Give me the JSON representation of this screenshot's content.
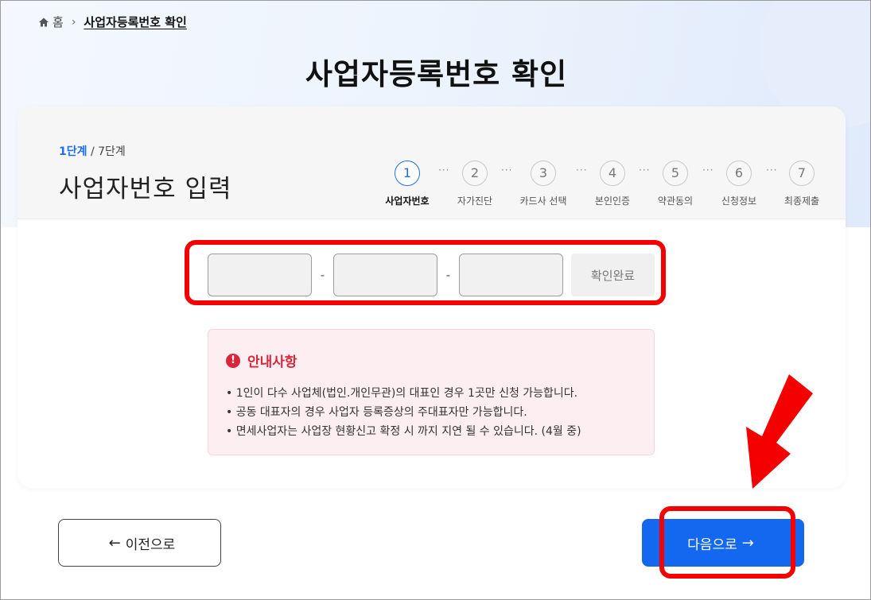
{
  "breadcrumb": {
    "home": "홈",
    "current": "사업자등록번호 확인"
  },
  "page_title": "사업자등록번호 확인",
  "step_indicator": {
    "current": "1단계",
    "total": " / 7단계"
  },
  "step_title": "사업자번호 입력",
  "steps": [
    {
      "num": "1",
      "label": "사업자번호"
    },
    {
      "num": "2",
      "label": "자가진단"
    },
    {
      "num": "3",
      "label": "카드사 선택"
    },
    {
      "num": "4",
      "label": "본인인증"
    },
    {
      "num": "5",
      "label": "약관동의"
    },
    {
      "num": "6",
      "label": "신청정보"
    },
    {
      "num": "7",
      "label": "최종제출"
    }
  ],
  "active_step": 1,
  "step_separator": "···",
  "biz_number": {
    "part1_value": "",
    "part2_value": "",
    "part3_value": "",
    "dash": "-",
    "confirm_label": "확인완료"
  },
  "notice": {
    "icon": "!",
    "title": "안내사항",
    "items": [
      "• 1인이 다수 사업체(법인.개인무관)의 대표인 경우 1곳만 신청 가능합니다.",
      "• 공동 대표자의 경우 사업자 등록증상의 주대표자만 가능합니다.",
      "• 면세사업자는 사업장 현황신고 확정 시 까지 지연 될 수 있습니다. (4월 중)"
    ]
  },
  "buttons": {
    "prev_label": "이전으로",
    "next_label": "다음으로"
  },
  "colors": {
    "accent": "#1468f0",
    "highlight": "#f40000",
    "notice_red": "#d9263b"
  }
}
